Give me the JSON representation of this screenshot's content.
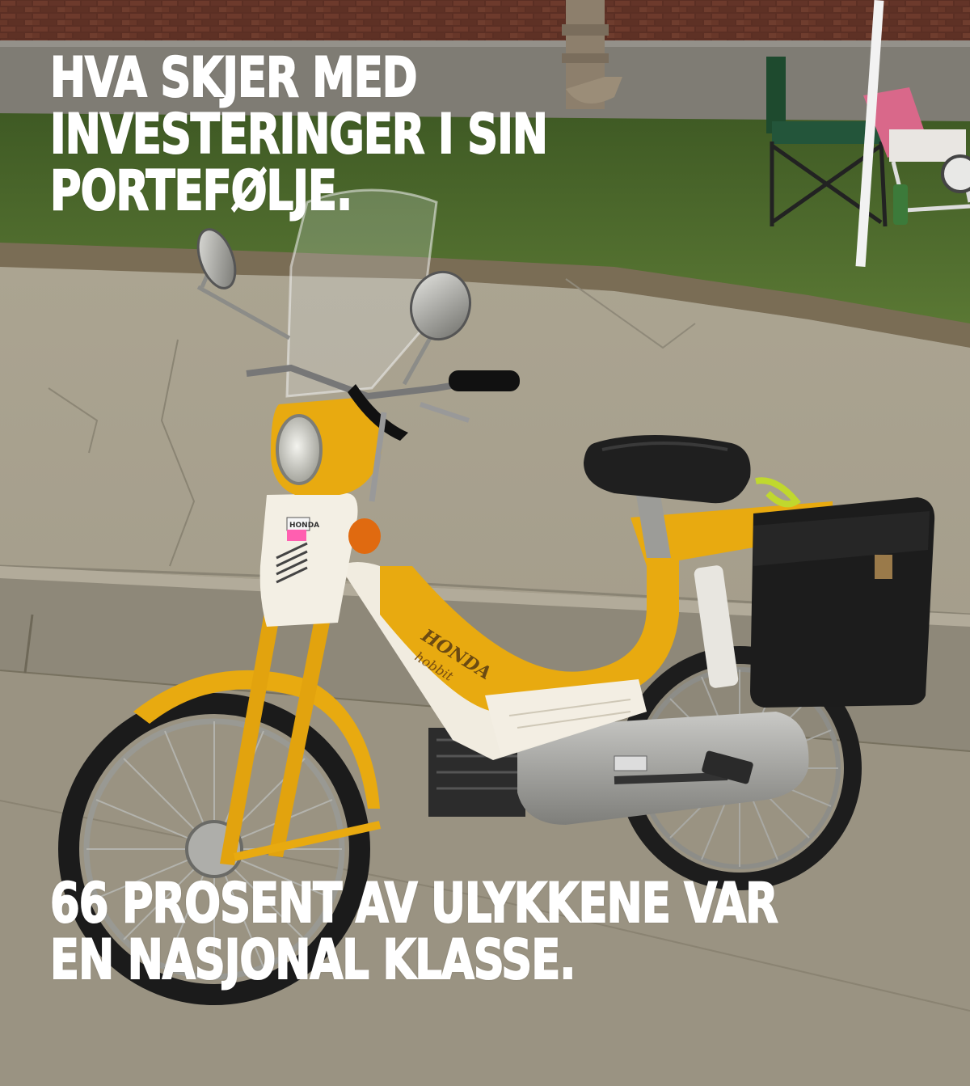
{
  "meme": {
    "top_text": [
      "HVA SKJER MED",
      "INVESTERINGER I SIN",
      "PORTEFØLJE."
    ],
    "bottom_text": [
      "66 PROSENT AV ULYKKENE VAR",
      "EN NASJONAL KLASSE."
    ]
  },
  "photo": {
    "brand_badge": "HONDA",
    "tank_logo": "HONDA",
    "model_logo": "hobbit",
    "bike_color": "#e8aa10",
    "colors": {
      "brick": "#5a2e22",
      "grass": "#4f6b2e",
      "pavement": "#a8a08f",
      "caption": "#ffffff"
    }
  }
}
